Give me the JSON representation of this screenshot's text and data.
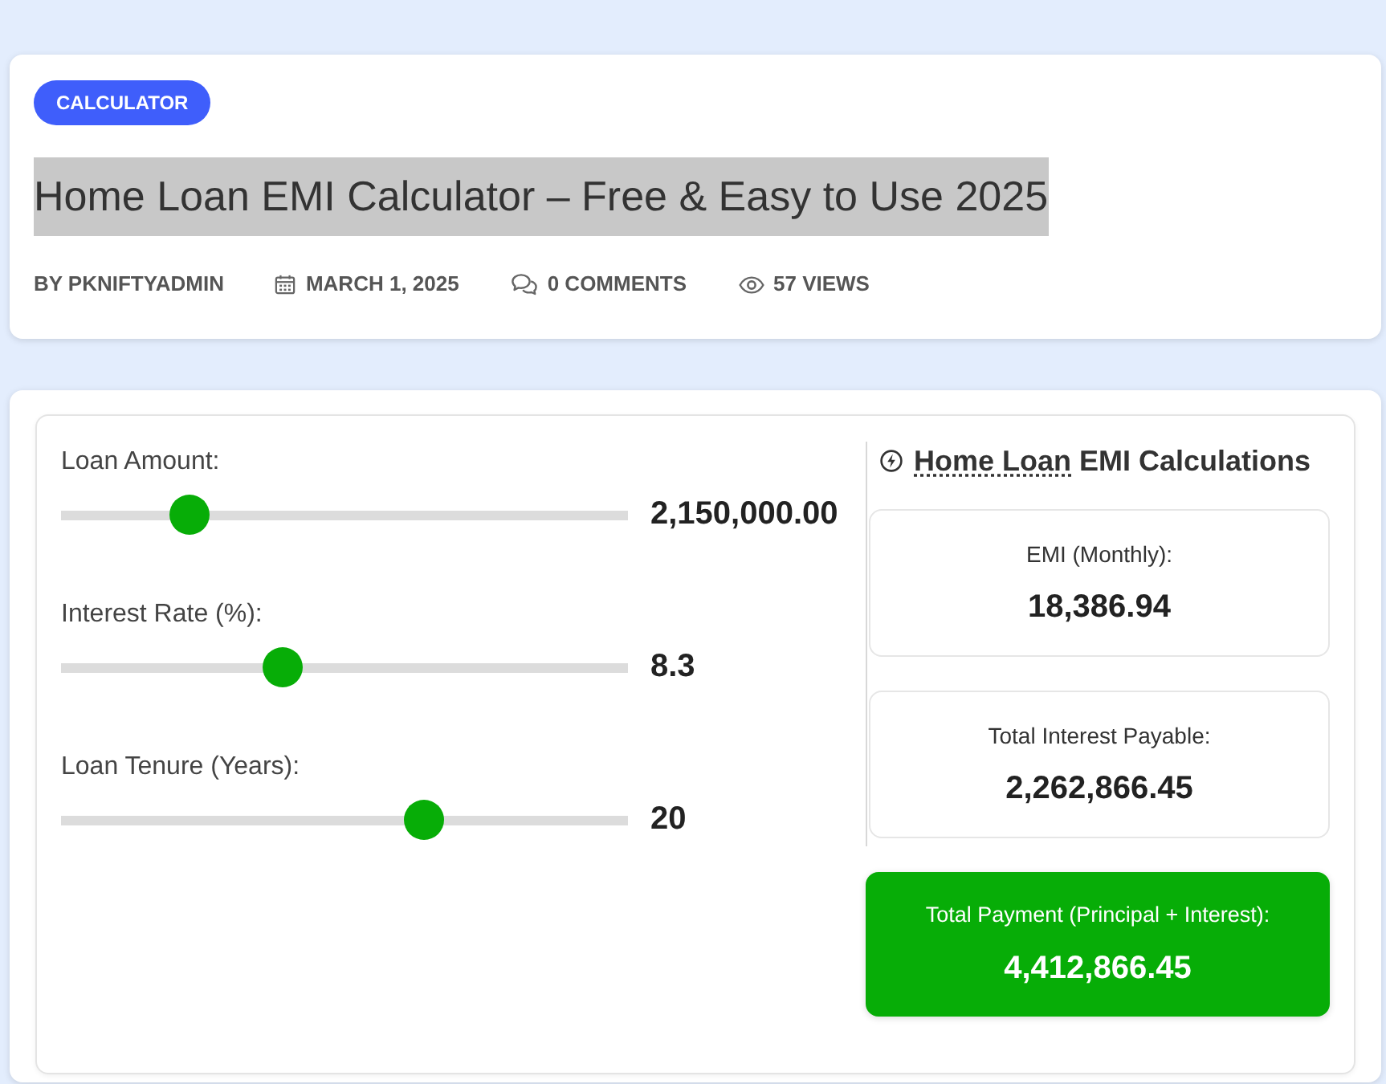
{
  "post_header": {
    "category_badge": "CALCULATOR",
    "title": {
      "text": "Home Loan EMI Calculator – Free & Easy to Use 2025",
      "highlighted": true
    },
    "meta": [
      {
        "kind": "author",
        "text": "BY PKNIFTYADMIN"
      },
      {
        "kind": "date",
        "text": "MARCH 1, 2025"
      },
      {
        "kind": "comments",
        "text": "0 COMMENTS"
      },
      {
        "kind": "views",
        "text": "57 VIEWS"
      }
    ]
  },
  "calculator": {
    "sliders": [
      {
        "label": "Loan Amount:",
        "level": 0.227,
        "reading": "2,150,000.00"
      },
      {
        "label": "Interest Rate (%):",
        "level": 0.39,
        "reading": "8.3"
      },
      {
        "label": "Loan Tenure (Years):",
        "level": 0.64,
        "reading": "20"
      }
    ],
    "results": {
      "heading": {
        "link": "Home Loan",
        "text": "EMI Calculations"
      },
      "cards": [
        {
          "kind": "plain",
          "label": "EMI (Monthly):",
          "value": "18,386.94"
        },
        {
          "kind": "plain",
          "label": "Total Interest Payable:",
          "value": "2,262,866.45"
        },
        {
          "kind": "highlight",
          "label": "Total Payment (Principal + Interest):",
          "value": "4,412,866.45"
        }
      ]
    }
  }
}
